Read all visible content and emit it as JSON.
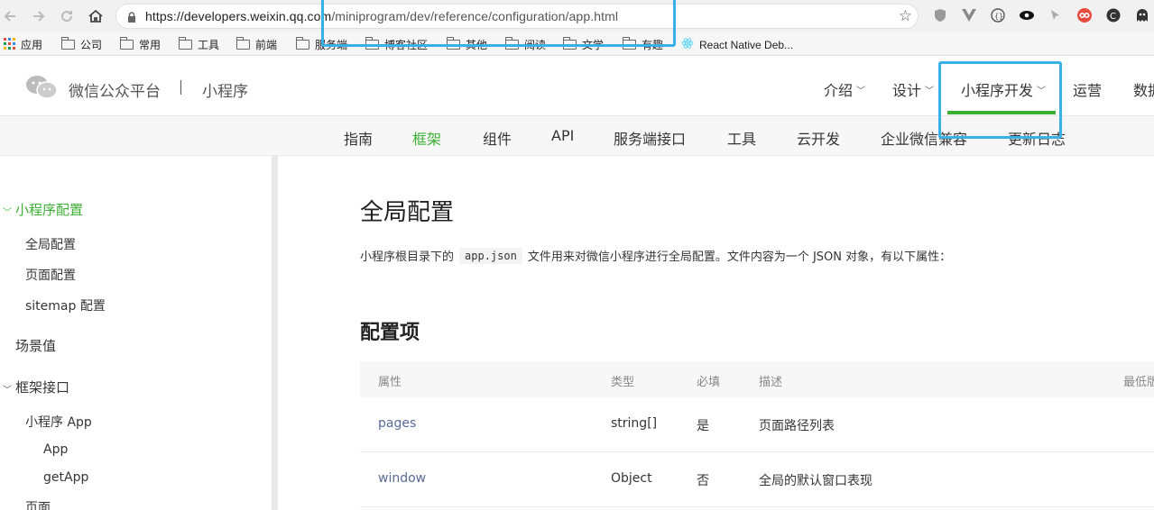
{
  "browser": {
    "url_host": "https://developers.weixin.qq.com",
    "url_path": "/miniprogram/dev/reference/configuration/app.html",
    "bookmarks": [
      "应用",
      "公司",
      "常用",
      "工具",
      "前端",
      "服务端",
      "博客社区",
      "其他",
      "阅读",
      "文学",
      "有趣",
      "React Native Deb..."
    ]
  },
  "header": {
    "brand": "微信公众平台",
    "sub_brand": "小程序",
    "nav": [
      {
        "label": "介绍",
        "caret": true
      },
      {
        "label": "设计",
        "caret": true
      },
      {
        "label": "小程序开发",
        "caret": true,
        "active": true
      },
      {
        "label": "运营",
        "caret": false
      },
      {
        "label": "数据",
        "caret": false
      }
    ]
  },
  "subnav": [
    "指南",
    "框架",
    "组件",
    "API",
    "服务端接口",
    "工具",
    "云开发",
    "企业微信兼容",
    "更新日志"
  ],
  "subnav_active": "框架",
  "sidebar": {
    "section1": "小程序配置",
    "section1_items": [
      "全局配置",
      "页面配置",
      "sitemap 配置"
    ],
    "section2": "场景值",
    "section3": "框架接口",
    "section3_sub": "小程序 App",
    "section3_sub_items": [
      "App",
      "getApp"
    ],
    "section4": "页面"
  },
  "main": {
    "title": "全局配置",
    "intro_before": "小程序根目录下的",
    "intro_code": "app.json",
    "intro_after": "文件用来对微信小程序进行全局配置。文件内容为一个 JSON 对象，有以下属性：",
    "section_title": "配置项",
    "table": {
      "headers": [
        "属性",
        "类型",
        "必填",
        "描述",
        "最低版本"
      ],
      "rows": [
        {
          "attr": "pages",
          "type": "string[]",
          "required": "是",
          "desc": "页面路径列表"
        },
        {
          "attr": "window",
          "type": "Object",
          "required": "否",
          "desc": "全局的默认窗口表现"
        }
      ]
    }
  },
  "colors": {
    "accent_green": "#3cb034",
    "link_blue": "#576b95",
    "highlight_box": "#3ab0e8"
  }
}
